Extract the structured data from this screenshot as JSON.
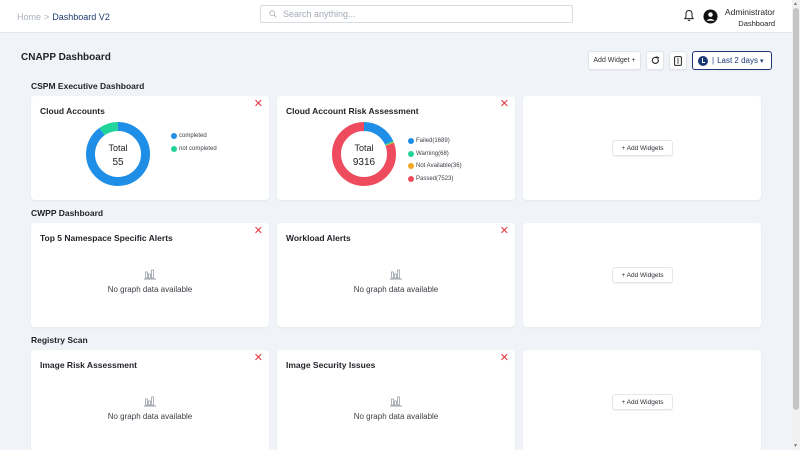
{
  "breadcrumb": {
    "home": "Home",
    "separator": ">",
    "current": "Dashboard V2"
  },
  "search": {
    "placeholder": "Search anything..."
  },
  "user": {
    "name": "Administrator",
    "role": "Dashboard"
  },
  "page": {
    "title": "CNAPP Dashboard"
  },
  "toolbar": {
    "add_widget_label": "Add Widget +",
    "time_pipe": "|",
    "time_label": "Last 2 days"
  },
  "icons": [
    "search-icon",
    "bell-icon",
    "user-icon",
    "refresh-icon",
    "more-icon",
    "clock-icon",
    "chevron-down-icon",
    "close-icon",
    "bar-chart-icon"
  ],
  "colors": {
    "brand": "#1d3a78",
    "close": "#e0383e",
    "blue": "#1e8ee6",
    "green": "#20d49a",
    "orange": "#f5a623",
    "red": "#ee4b5f"
  },
  "sections": [
    {
      "title": "CSPM Executive Dashboard",
      "cards": [
        {
          "title": "Cloud Accounts",
          "close": "✕",
          "total_label": "Total",
          "total_value": "55",
          "chart_data": {
            "type": "pie",
            "values": [
              90,
              10
            ]
          },
          "legend": [
            {
              "label": "completed",
              "color": "#1e8ee6"
            },
            {
              "label": "not completed",
              "color": "#20d49a"
            }
          ]
        },
        {
          "title": "Cloud Account Risk Assessment",
          "close": "✕",
          "total_label": "Total",
          "total_value": "9316",
          "chart_data": {
            "type": "pie",
            "values": [
              1689,
              68,
              36,
              7523
            ]
          },
          "legend": [
            {
              "label": "Failed(1689)",
              "color": "#1e8ee6"
            },
            {
              "label": "Warning(68)",
              "color": "#20d49a"
            },
            {
              "label": "Not Available(36)",
              "color": "#f5a623"
            },
            {
              "label": "Passed(7523)",
              "color": "#ee4b5f"
            }
          ]
        }
      ],
      "add_widgets_label": "+ Add Widgets"
    },
    {
      "title": "CWPP Dashboard",
      "cards": [
        {
          "title": "Top 5 Namespace Specific Alerts",
          "close": "✕",
          "empty_text": "No graph data available"
        },
        {
          "title": "Workload Alerts",
          "close": "✕",
          "empty_text": "No graph data available"
        }
      ],
      "add_widgets_label": "+ Add Widgets"
    },
    {
      "title": "Registry Scan",
      "cards": [
        {
          "title": "Image Risk Assessment",
          "close": "✕",
          "empty_text": "No graph data available"
        },
        {
          "title": "Image Security Issues",
          "close": "✕",
          "empty_text": "No graph data available"
        }
      ],
      "add_widgets_label": "+ Add Widgets"
    }
  ]
}
